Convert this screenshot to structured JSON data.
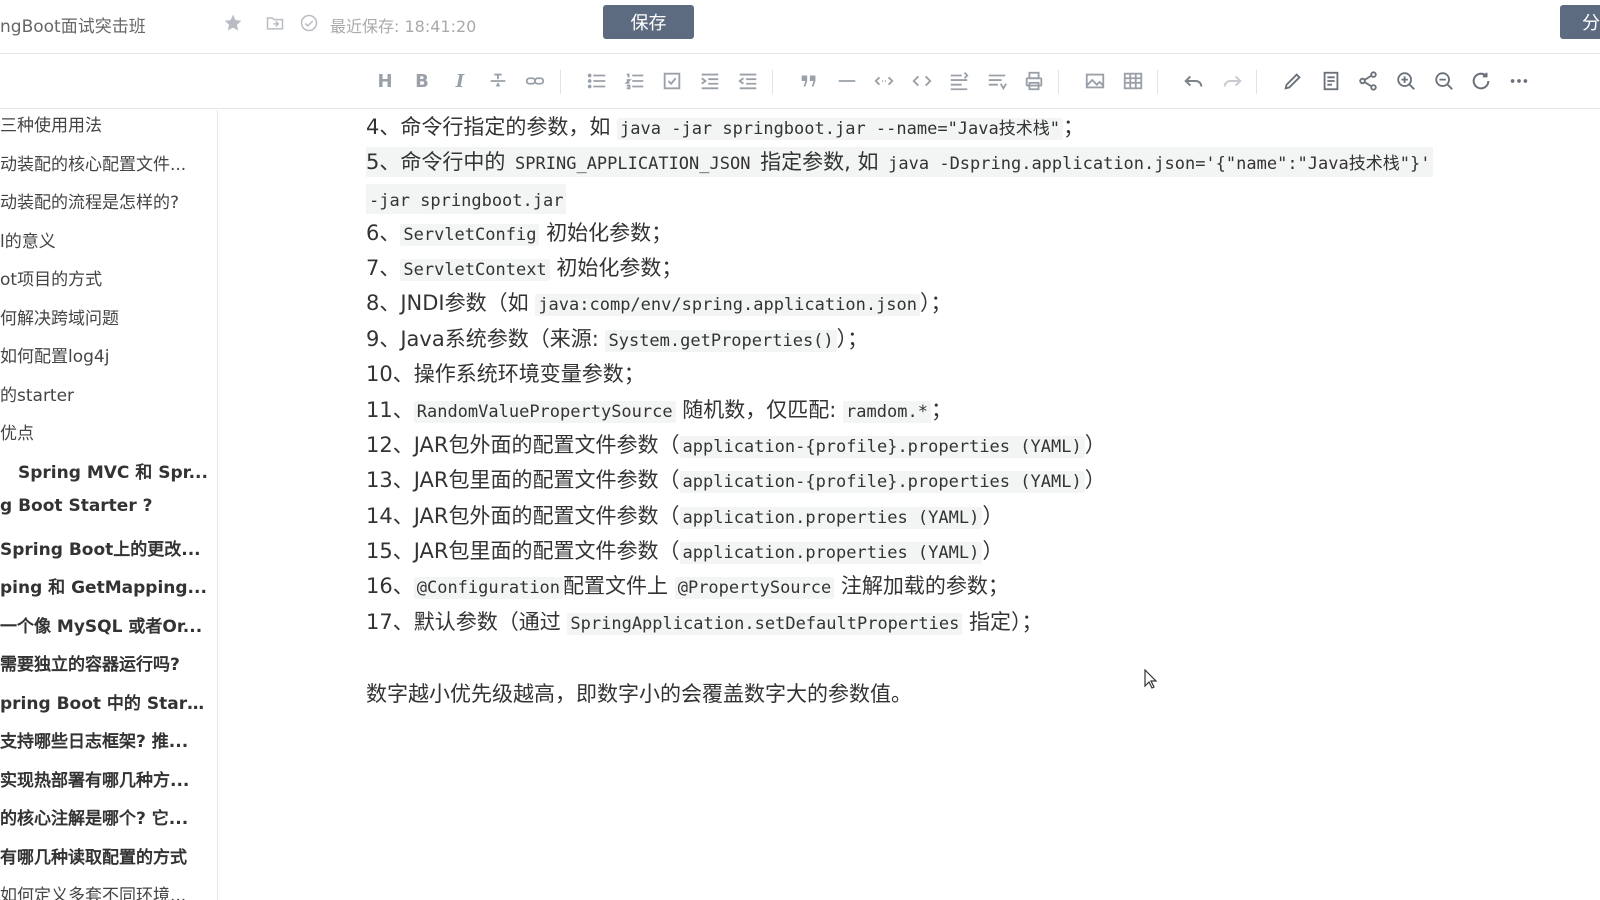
{
  "header": {
    "doc_title": "ngBoot面试突击班",
    "last_saved": "最近保存: 18:41:20",
    "save_label": "保存",
    "share_label": "分"
  },
  "toolbar": {
    "icons": [
      "heading-icon",
      "bold-icon",
      "italic-icon",
      "strikethrough-icon",
      "link-icon",
      "bullet-list-icon",
      "numbered-list-icon",
      "checkbox-icon",
      "indent-icon",
      "outdent-icon",
      "quote-icon",
      "horizontal-rule-icon",
      "inline-code-icon",
      "code-block-icon",
      "toc-icon",
      "format-icon",
      "print-icon",
      "image-icon",
      "table-icon",
      "undo-icon",
      "redo-icon",
      "edit-icon",
      "preview-icon",
      "share-icon",
      "zoom-in-icon",
      "zoom-out-icon",
      "refresh-icon",
      "more-icon"
    ]
  },
  "sidebar": {
    "items": [
      {
        "label": "三种使用用法",
        "bold": false
      },
      {
        "label": "动装配的核心配置文件...",
        "bold": false
      },
      {
        "label": "动装配的流程是怎样的?",
        "bold": false
      },
      {
        "label": "l的意义",
        "bold": false
      },
      {
        "label": "ot项目的方式",
        "bold": false
      },
      {
        "label": "何解决跨域问题",
        "bold": false
      },
      {
        "label": "如何配置log4j",
        "bold": false
      },
      {
        "label": "的starter",
        "bold": false
      },
      {
        "label": "优点",
        "bold": false
      },
      {
        "label": "Spring MVC 和 Spr...",
        "bold": true
      },
      {
        "label": "g Boot Starter ?",
        "bold": true
      },
      {
        "label": "Spring Boot上的更改...",
        "bold": true
      },
      {
        "label": "ping 和 GetMapping...",
        "bold": true
      },
      {
        "label": "一个像 MySQL 或者Or...",
        "bold": true
      },
      {
        "label": "需要独立的容器运行吗?",
        "bold": true
      },
      {
        "label": "pring Boot 中的 Start...",
        "bold": true
      },
      {
        "label": "支持哪些日志框架? 推...",
        "bold": true
      },
      {
        "label": "实现热部署有哪几种方...",
        "bold": true
      },
      {
        "label": "的核心注解是哪个? 它...",
        "bold": true
      },
      {
        "label": "有哪几种读取配置的方式",
        "bold": true
      },
      {
        "label": "如何定义多套不同环境...",
        "bold": false
      }
    ]
  },
  "content": {
    "lines": [
      {
        "parts": [
          {
            "t": "4、命令行指定的参数，如 ",
            "c": false
          },
          {
            "t": "java -jar springboot.jar --name=\"Java技术栈\"",
            "c": true
          },
          {
            "t": "；",
            "c": false
          }
        ]
      },
      {
        "parts": [
          {
            "t": "5、命令行中的 ",
            "c": false
          },
          {
            "t": "SPRING_APPLICATION_JSON",
            "c": true
          },
          {
            "t": " 指定参数, 如 ",
            "c": false
          },
          {
            "t": "java -Dspring.application.json='{\"name\":\"Java技术栈\"}'",
            "c": true
          }
        ]
      },
      {
        "parts": [
          {
            "t": "-jar springboot.jar",
            "c": true
          }
        ]
      },
      {
        "parts": [
          {
            "t": "6、",
            "c": false
          },
          {
            "t": "ServletConfig",
            "c": true
          },
          {
            "t": " 初始化参数；",
            "c": false
          }
        ]
      },
      {
        "parts": [
          {
            "t": "7、",
            "c": false
          },
          {
            "t": "ServletContext",
            "c": true
          },
          {
            "t": " 初始化参数；",
            "c": false
          }
        ]
      },
      {
        "parts": [
          {
            "t": "8、JNDI参数（如 ",
            "c": false
          },
          {
            "t": "java:comp/env/spring.application.json",
            "c": true
          },
          {
            "t": "）；",
            "c": false
          }
        ]
      },
      {
        "parts": [
          {
            "t": "9、Java系统参数（来源: ",
            "c": false
          },
          {
            "t": "System.getProperties()",
            "c": true
          },
          {
            "t": "）；",
            "c": false
          }
        ]
      },
      {
        "parts": [
          {
            "t": "10、操作系统环境变量参数；",
            "c": false
          }
        ]
      },
      {
        "parts": [
          {
            "t": "11、",
            "c": false
          },
          {
            "t": "RandomValuePropertySource",
            "c": true
          },
          {
            "t": " 随机数，仅匹配: ",
            "c": false
          },
          {
            "t": "ramdom.*",
            "c": true
          },
          {
            "t": "；",
            "c": false
          }
        ]
      },
      {
        "parts": [
          {
            "t": "12、JAR包外面的配置文件参数（",
            "c": false
          },
          {
            "t": "application-{profile}.properties (YAML)",
            "c": true
          },
          {
            "t": "）",
            "c": false
          }
        ]
      },
      {
        "parts": [
          {
            "t": "13、JAR包里面的配置文件参数（",
            "c": false
          },
          {
            "t": "application-{profile}.properties (YAML)",
            "c": true
          },
          {
            "t": "）",
            "c": false
          }
        ]
      },
      {
        "parts": [
          {
            "t": "14、JAR包外面的配置文件参数（",
            "c": false
          },
          {
            "t": "application.properties (YAML)",
            "c": true
          },
          {
            "t": "）",
            "c": false
          }
        ]
      },
      {
        "parts": [
          {
            "t": "15、JAR包里面的配置文件参数（",
            "c": false
          },
          {
            "t": "application.properties (YAML)",
            "c": true
          },
          {
            "t": "）",
            "c": false
          }
        ]
      },
      {
        "parts": [
          {
            "t": "16、",
            "c": false
          },
          {
            "t": "@Configuration",
            "c": true
          },
          {
            "t": "配置文件上 ",
            "c": false
          },
          {
            "t": "@PropertySource",
            "c": true
          },
          {
            "t": " 注解加载的参数；",
            "c": false
          }
        ]
      },
      {
        "parts": [
          {
            "t": "17、默认参数（通过 ",
            "c": false
          },
          {
            "t": "SpringApplication.setDefaultProperties",
            "c": true
          },
          {
            "t": " 指定）；",
            "c": false
          }
        ]
      }
    ],
    "summary": "数字越小优先级越高，即数字小的会覆盖数字大的参数值。"
  }
}
